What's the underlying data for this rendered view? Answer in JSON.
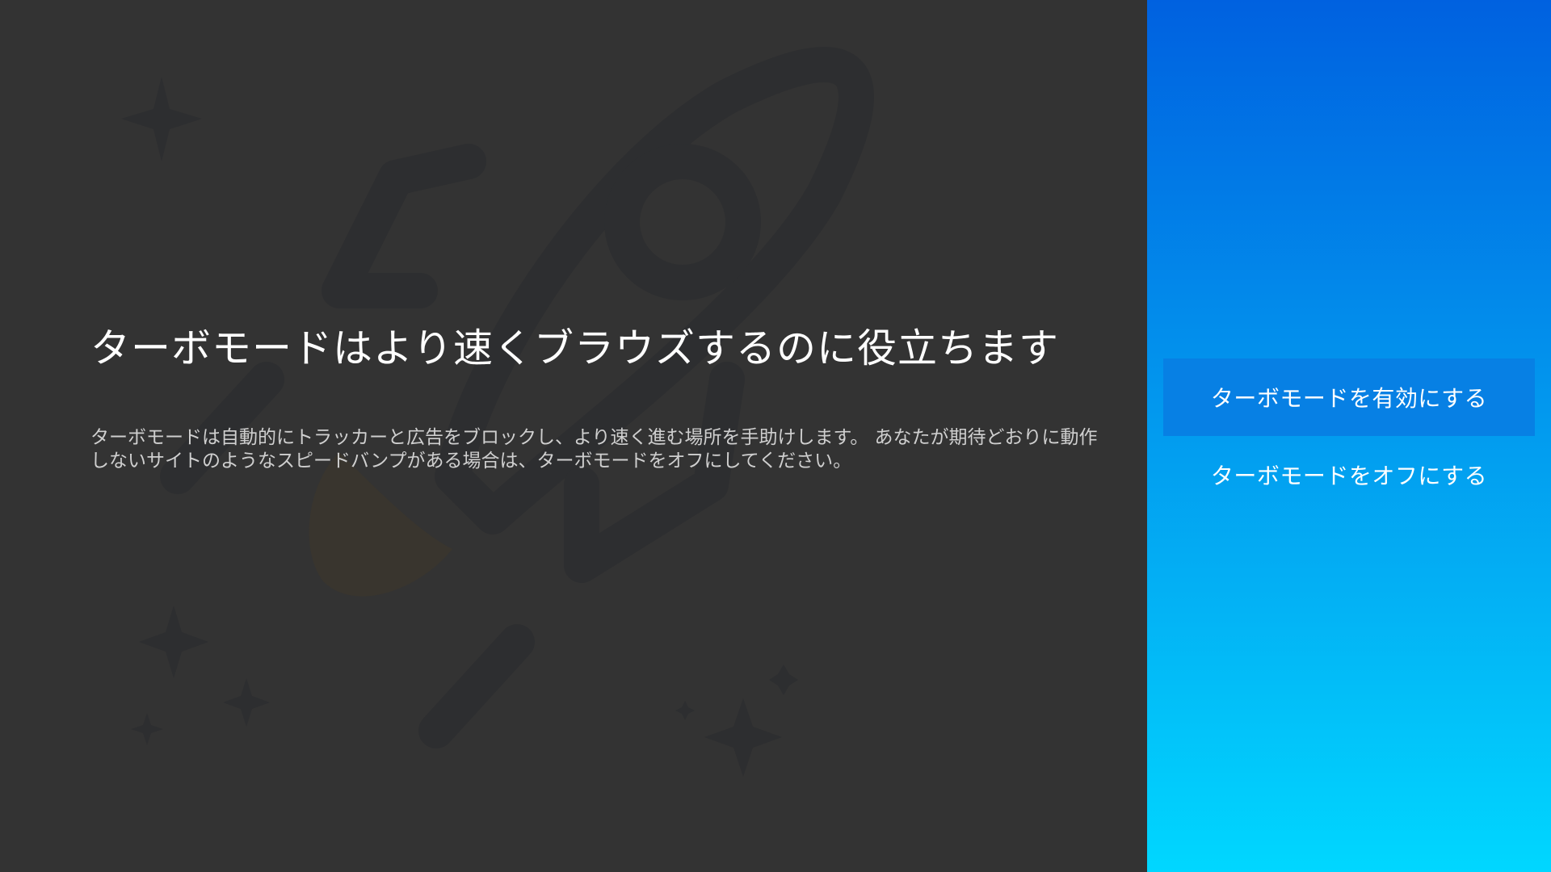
{
  "main": {
    "title": "ターボモードはより速くブラウズするのに役立ちます",
    "description": "ターボモードは自動的にトラッカーと広告をブロックし、より速く進む場所を手助けします。 あなたが期待どおりに動作しないサイトのようなスピードバンプがある場合は、ターボモードをオフにしてください。"
  },
  "menu": {
    "items": [
      {
        "label": "ターボモードを有効にする",
        "focused": true
      },
      {
        "label": "ターボモードをオフにする",
        "focused": false
      }
    ]
  },
  "colors": {
    "background": "#333333",
    "panel_gradient_top": "#0061e0",
    "panel_gradient_bottom": "#00d7ff",
    "focus_highlight": "#0780e4"
  }
}
